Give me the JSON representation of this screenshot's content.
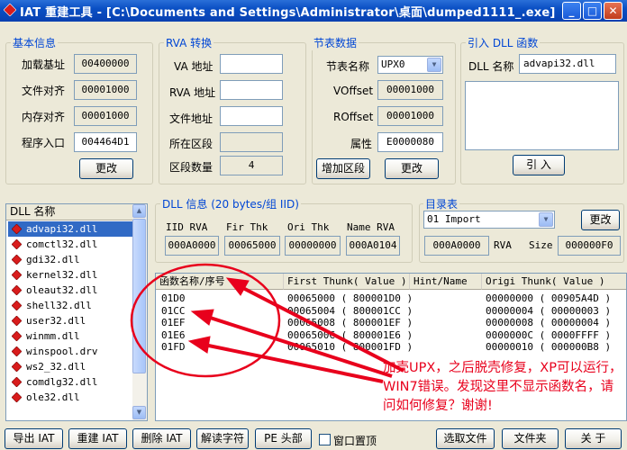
{
  "window": {
    "title": "IAT 重建工具 - [C:\\Documents and Settings\\Administrator\\桌面\\dumped1111_.exe]",
    "min": "_",
    "max": "□",
    "close": "✕"
  },
  "basic": {
    "title": "基本信息",
    "rows": [
      {
        "label": "加载基址",
        "value": "00400000"
      },
      {
        "label": "文件对齐",
        "value": "00001000"
      },
      {
        "label": "内存对齐",
        "value": "00001000"
      },
      {
        "label": "程序入口",
        "value": "004464D1"
      }
    ],
    "change": "更改"
  },
  "rva": {
    "title": "RVA 转换",
    "rows": [
      {
        "label": "VA 地址",
        "value": ""
      },
      {
        "label": "RVA 地址",
        "value": ""
      },
      {
        "label": "文件地址",
        "value": ""
      },
      {
        "label": "所在区段",
        "value": ""
      },
      {
        "label": "区段数量",
        "value": "4"
      }
    ]
  },
  "section": {
    "title": "节表数据",
    "name_label": "节表名称",
    "name_value": "UPX0",
    "voffset_label": "VOffset",
    "voffset_value": "00001000",
    "roffset_label": "ROffset",
    "roffset_value": "00001000",
    "attr_label": "属性",
    "attr_value": "E0000080",
    "add": "增加区段",
    "change": "更改"
  },
  "import_dll": {
    "title": "引入 DLL 函数",
    "name_label": "DLL 名称",
    "name_value": "advapi32.dll",
    "import_button": "引  入"
  },
  "dll_list": {
    "header": "DLL 名称",
    "items": [
      "advapi32.dll",
      "comctl32.dll",
      "gdi32.dll",
      "kernel32.dll",
      "oleaut32.dll",
      "shell32.dll",
      "user32.dll",
      "winmm.dll",
      "winspool.drv",
      "ws2_32.dll",
      "comdlg32.dll",
      "ole32.dll"
    ],
    "selected_index": 0
  },
  "dll_info": {
    "title": "DLL 信息 (20 bytes/组 IID)",
    "cols": [
      {
        "label": "IID RVA",
        "value": "000A0000"
      },
      {
        "label": "Fir Thk",
        "value": "00065000"
      },
      {
        "label": "Ori Thk",
        "value": "00000000"
      },
      {
        "label": "Name RVA",
        "value": "000A0104"
      }
    ]
  },
  "directory": {
    "title": "目录表",
    "selected": "01 Import",
    "change": "更改",
    "rva_value": "000A0000",
    "rva_label": "RVA",
    "size_label": "Size",
    "size_value": "000000F0"
  },
  "thunks": {
    "headers": [
      "函数名称/序号",
      "First Thunk( Value )",
      "Hint/Name",
      "Origi Thunk( Value )"
    ],
    "rows": [
      [
        "01D0",
        "00065000 ( 800001D0 )",
        "",
        "00000000 ( 00905A4D )"
      ],
      [
        "01CC",
        "00065004 ( 800001CC )",
        "",
        "00000004 ( 00000003 )"
      ],
      [
        "01EF",
        "00065008 ( 800001EF )",
        "",
        "00000008 ( 00000004 )"
      ],
      [
        "01E6",
        "0006500C ( 800001E6 )",
        "",
        "0000000C ( 0000FFFF )"
      ],
      [
        "01FD",
        "00065010 ( 800001FD )",
        "",
        "00000010 ( 000000B8 )"
      ]
    ]
  },
  "annotation": "加壳UPX，之后脱壳修复，XP可以运行，WIN7错误。发现这里不显示函数名，请问如何修复？谢谢!",
  "toolbar": {
    "export_iat": "导出 IAT",
    "rebuild_iat": "重建 IAT",
    "delete_iat": "删除 IAT",
    "decode_chars": "解读字符",
    "pe_header": "PE 头部",
    "topmost": "窗口置顶",
    "select_file": "选取文件",
    "folder": "文件夹",
    "about": "关  于"
  },
  "colors": {
    "accent": "#0046d5",
    "annotation": "#e8001c",
    "selection": "#316ac5"
  }
}
